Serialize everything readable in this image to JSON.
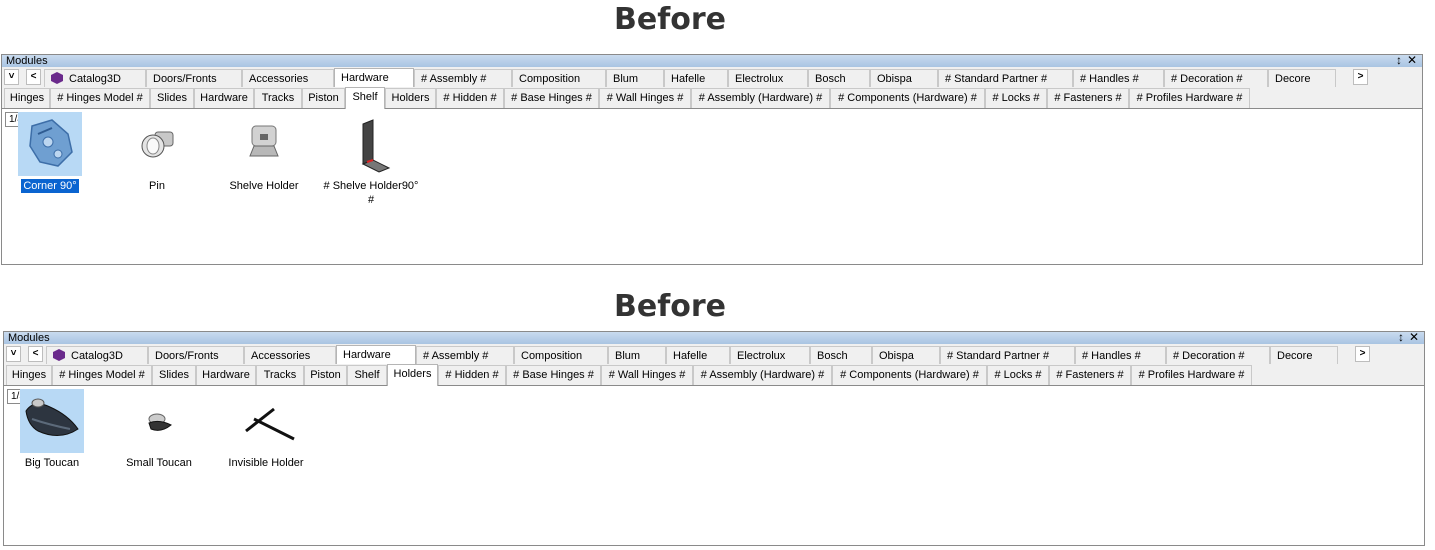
{
  "panels": [
    {
      "heading": "Before",
      "title": "Modules",
      "pin_glyph": "↕",
      "close_glyph": "✕",
      "nav_down": "˅",
      "nav_left": "<",
      "nav_right": ">",
      "tabs": [
        "Catalog3D",
        "Doors/Fronts",
        "Accessories",
        "Hardware",
        "# Assembly #",
        "Composition",
        "Blum",
        "Hafelle",
        "Electrolux",
        "Bosch",
        "Obispa",
        "# Standard Partner #",
        "# Handles #",
        "# Decoration #",
        "Decore"
      ],
      "active_tab": "Hardware",
      "subtabs": [
        "Hinges",
        "# Hinges Model #",
        "Slides",
        "Hardware",
        "Tracks",
        "Piston",
        "Shelf",
        "Holders",
        "# Hidden #",
        "# Base Hinges #",
        "# Wall Hinges #",
        "# Assembly (Hardware) #",
        "# Components (Hardware) #",
        "# Locks #",
        "# Fasteners #",
        "# Profiles Hardware #"
      ],
      "active_subtab": "Shelf",
      "page": "1/4",
      "items": [
        {
          "label": "Corner 90°",
          "icon": "corner-bracket-icon",
          "selected": true
        },
        {
          "label": "Pin",
          "icon": "shelf-pin-icon",
          "selected": false
        },
        {
          "label": "Shelve Holder",
          "icon": "shelve-holder-icon",
          "selected": false
        },
        {
          "label": "# Shelve Holder90° #",
          "icon": "angle-bracket-icon",
          "selected": false
        }
      ]
    },
    {
      "heading": "Before",
      "title": "Modules",
      "pin_glyph": "↕",
      "close_glyph": "✕",
      "nav_down": "˅",
      "nav_left": "<",
      "nav_right": ">",
      "tabs": [
        "Catalog3D",
        "Doors/Fronts",
        "Accessories",
        "Hardware",
        "# Assembly #",
        "Composition",
        "Blum",
        "Hafelle",
        "Electrolux",
        "Bosch",
        "Obispa",
        "# Standard Partner #",
        "# Handles #",
        "# Decoration #",
        "Decore"
      ],
      "active_tab": "Hardware",
      "subtabs": [
        "Hinges",
        "# Hinges Model #",
        "Slides",
        "Hardware",
        "Tracks",
        "Piston",
        "Shelf",
        "Holders",
        "# Hidden #",
        "# Base Hinges #",
        "# Wall Hinges #",
        "# Assembly (Hardware) #",
        "# Components (Hardware) #",
        "# Locks #",
        "# Fasteners #",
        "# Profiles Hardware #"
      ],
      "active_subtab": "Holders",
      "page": "1/3",
      "items": [
        {
          "label": "Big Toucan",
          "icon": "big-toucan-icon",
          "selected": true
        },
        {
          "label": "Small Toucan",
          "icon": "small-toucan-icon",
          "selected": false
        },
        {
          "label": "Invisible Holder",
          "icon": "invisible-holder-icon",
          "selected": false
        }
      ]
    }
  ]
}
